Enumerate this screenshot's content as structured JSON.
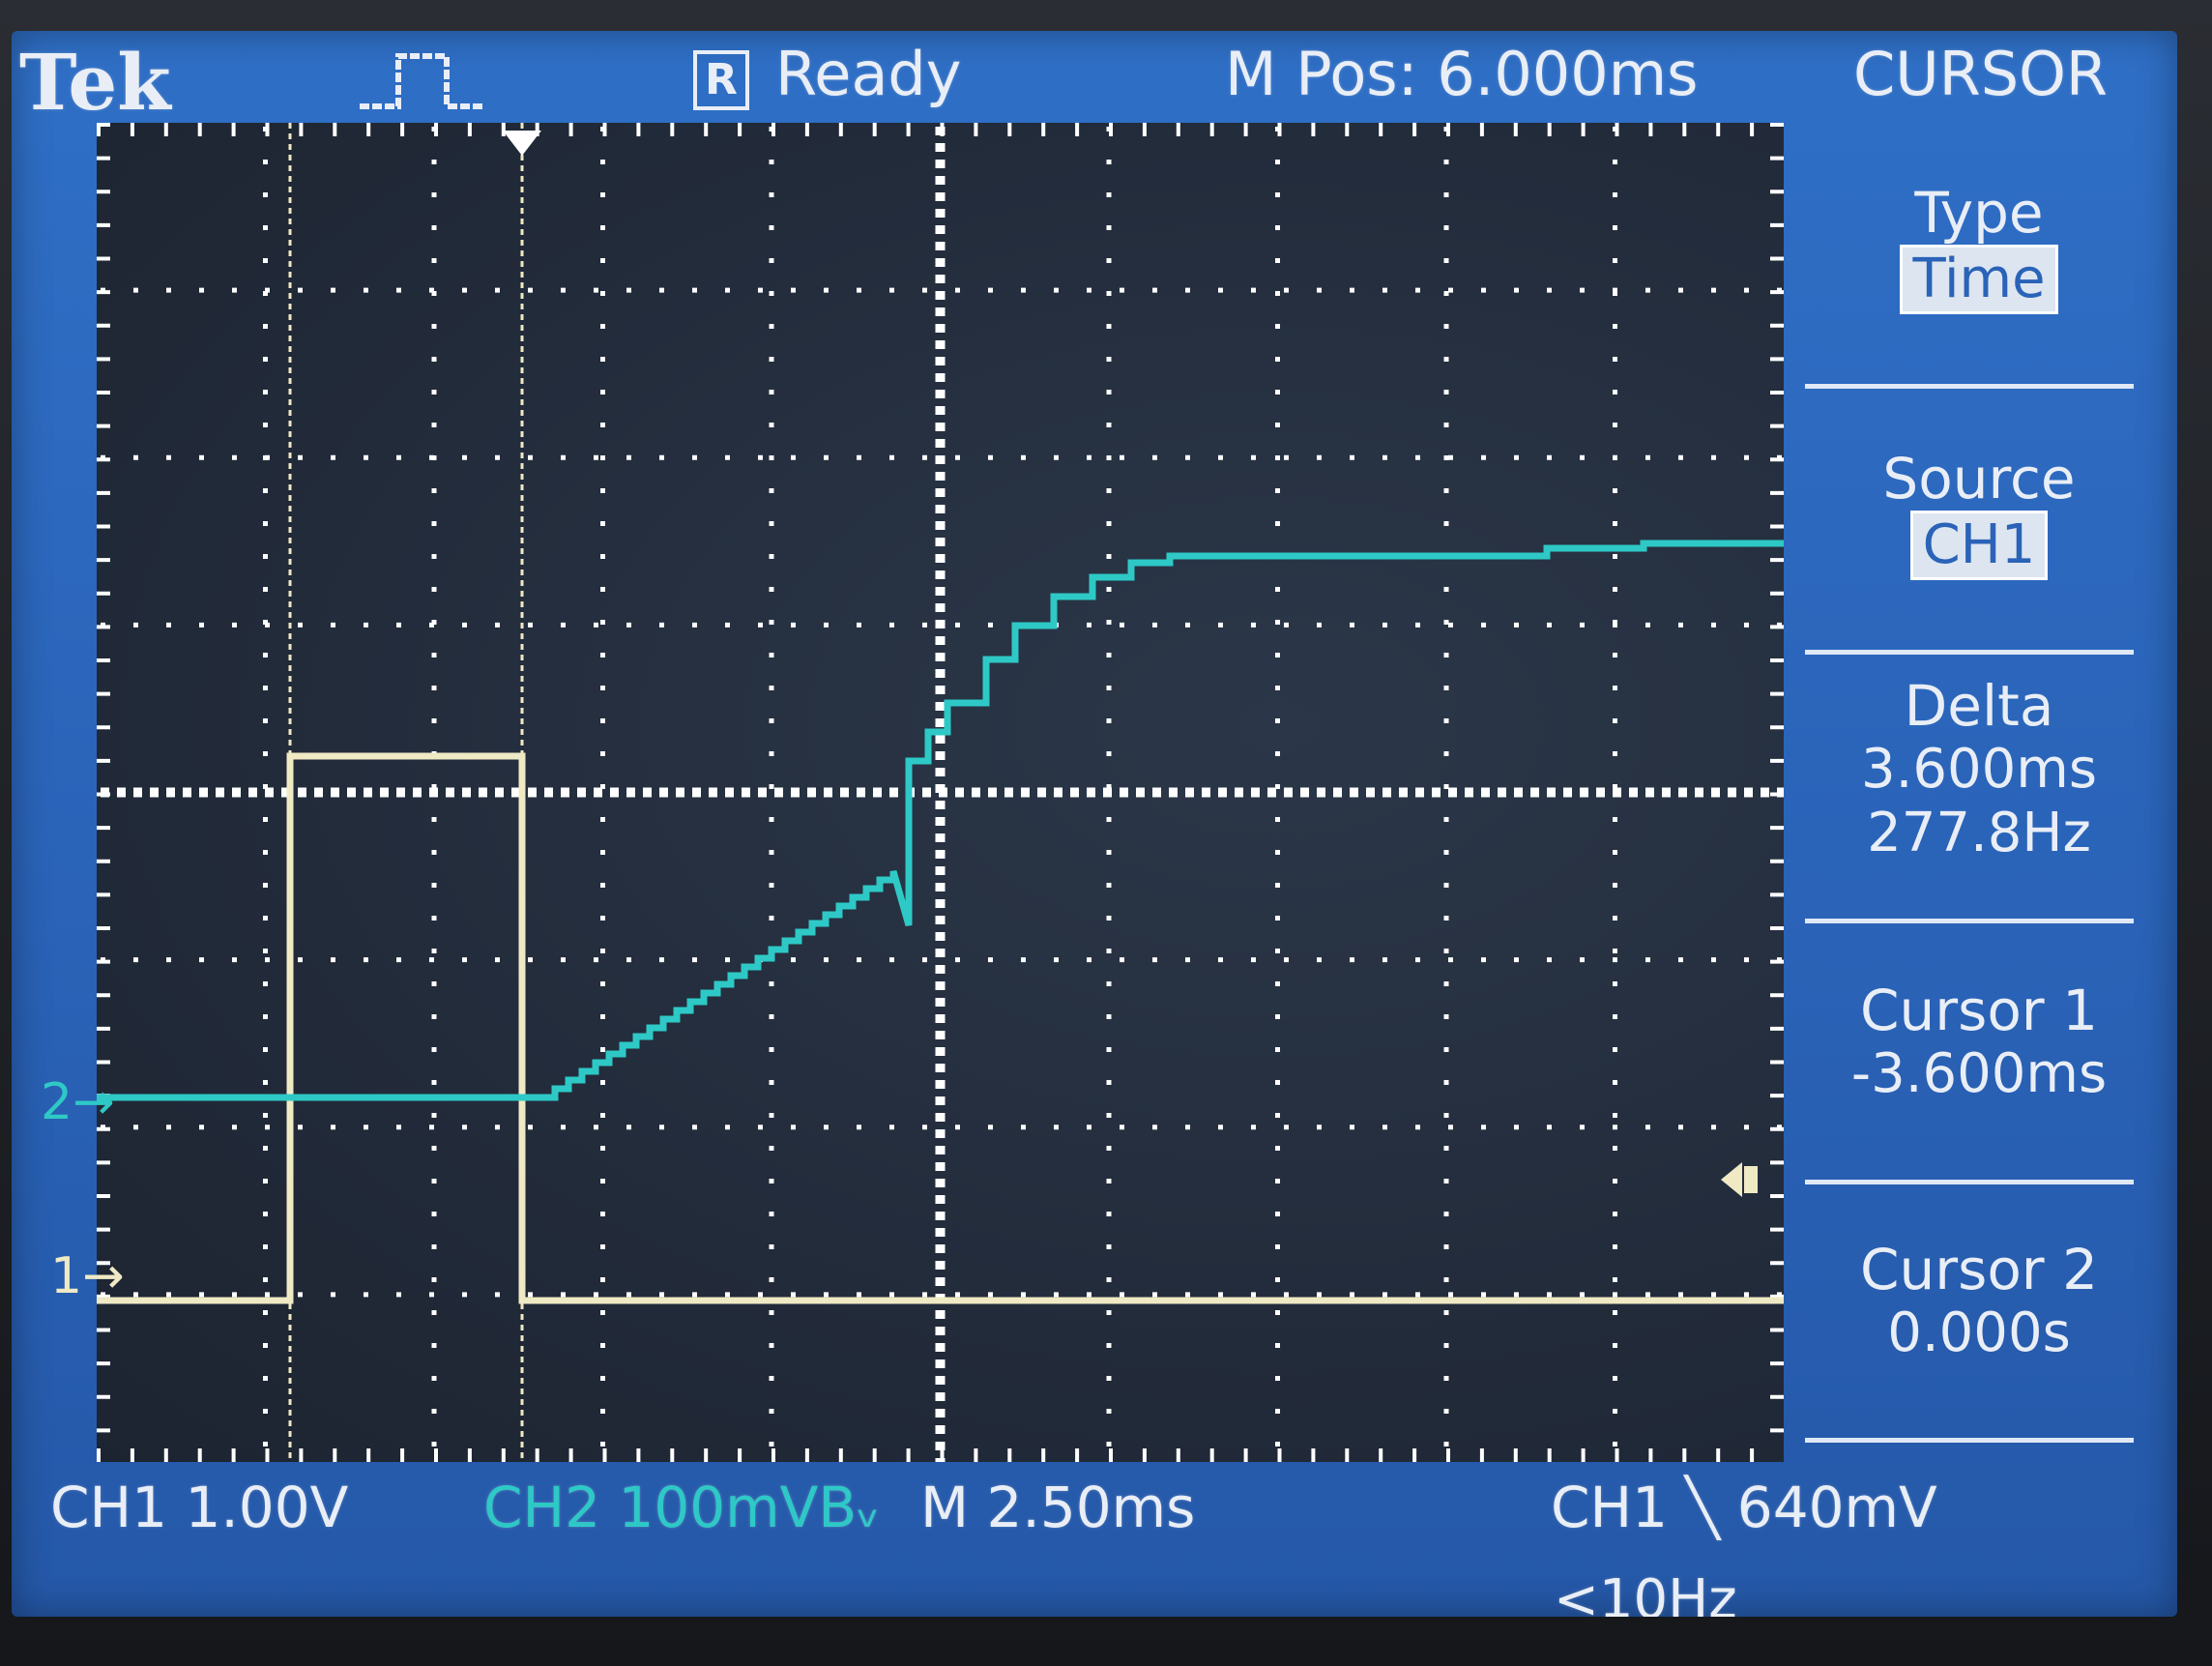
{
  "header": {
    "brand": "Tek",
    "status_icon": "R",
    "status": "Ready",
    "horizontal_position": "M Pos: 6.000ms",
    "menu_title": "CURSOR"
  },
  "side_menu": {
    "type_label": "Type",
    "type_value": "Time",
    "source_label": "Source",
    "source_value": "CH1",
    "delta_label": "Delta",
    "delta_time": "3.600ms",
    "delta_freq": "277.8Hz",
    "cursor1_label": "Cursor 1",
    "cursor1_value": "-3.600ms",
    "cursor2_label": "Cursor 2",
    "cursor2_value": "0.000s"
  },
  "footer": {
    "ch1_scale": "CH1  1.00V",
    "ch2_scale": "CH2  100mVBᵥ",
    "timebase": "M 2.50ms",
    "trigger": "CH1 ╲ 640mV",
    "trigger_frequency": "<10Hz"
  },
  "markers": {
    "ch1": "1→",
    "ch2": "2→"
  },
  "colors": {
    "screen_bg": "#2a63b8",
    "grid_bg": "#222b3a",
    "ch1_trace": "#efe9c4",
    "ch2_trace": "#2ec9c6",
    "grid_dots": "#ffffff"
  }
}
